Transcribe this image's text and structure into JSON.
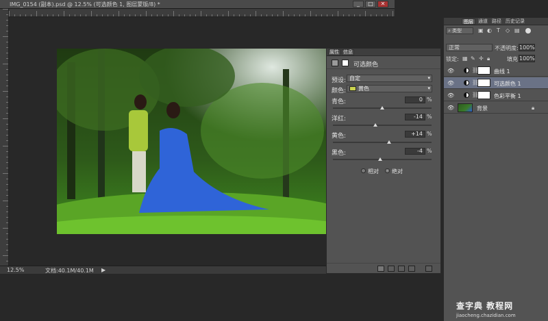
{
  "document": {
    "title": "IMG_0154 (副本).psd @ 12.5% (可选颜色 1, 图层蒙版/8) *",
    "window_buttons": {
      "minimize": "_",
      "maximize": "□",
      "close": "✕"
    },
    "status_zoom": "12.5%",
    "status_doc": "文档:40.1M/40.1M",
    "status_arrow": "▶"
  },
  "properties": {
    "tabs": [
      "属性",
      "信息"
    ],
    "header_title": "可选颜色",
    "preset_label": "预设:",
    "preset_value": "自定",
    "colors_label": "颜色:",
    "colors_value": "黄色",
    "sliders": [
      {
        "label": "青色:",
        "value": "0"
      },
      {
        "label": "洋红:",
        "value": "-14"
      },
      {
        "label": "黄色:",
        "value": "+14"
      },
      {
        "label": "黑色:",
        "value": "-4"
      }
    ],
    "pct": "%",
    "method": {
      "relative": "相对",
      "absolute": "绝对",
      "selected": "absolute"
    }
  },
  "layers": {
    "tabs": [
      "图层",
      "通道",
      "路径",
      "历史记录"
    ],
    "filter_label": "⌕ 类型",
    "blend_mode": "正常",
    "opacity_label": "不透明度:",
    "opacity_value": "100%",
    "lock_label": "锁定:",
    "fill_label": "填充:",
    "fill_value": "100%",
    "rows": [
      {
        "name": "曲线 1"
      },
      {
        "name": "可选颜色 1"
      },
      {
        "name": "色彩平衡 1"
      },
      {
        "name": "背景"
      }
    ]
  },
  "watermark": {
    "main": "查字典 教程网",
    "sub": "jiaocheng.chazidian.com"
  },
  "colors": {
    "swatch": "#cbd44f",
    "selected_layer": "#6a7286",
    "panel": "#535353"
  }
}
